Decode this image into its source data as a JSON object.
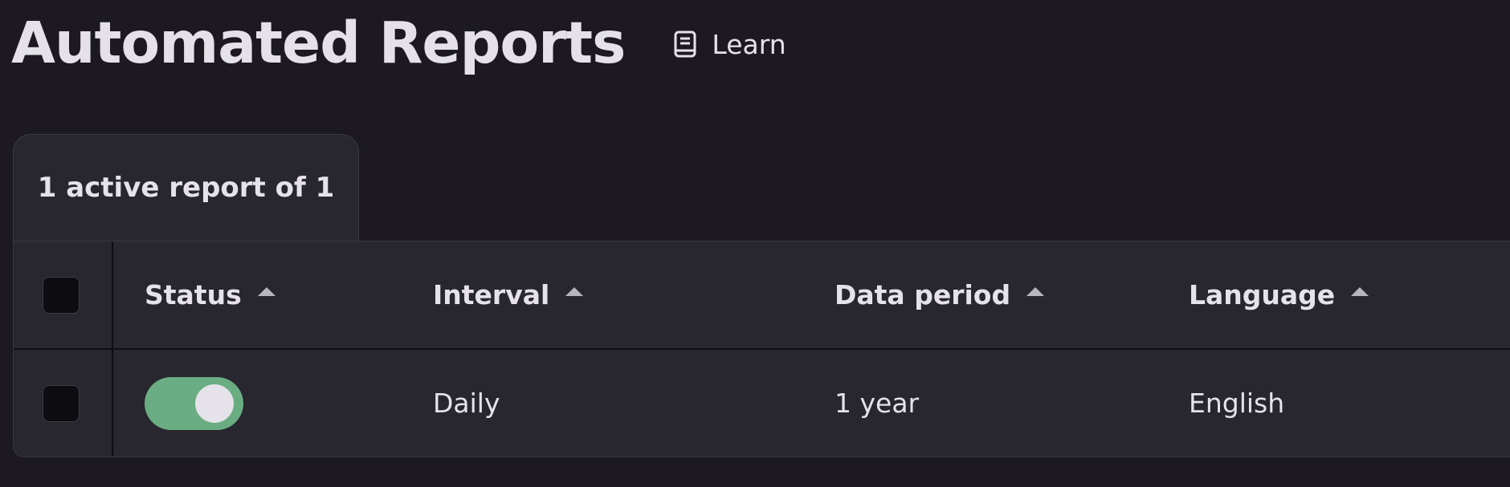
{
  "header": {
    "title": "Automated Reports",
    "learn_label": "Learn",
    "learn_icon": "book-icon"
  },
  "tab": {
    "label": "1 active report of 1"
  },
  "table": {
    "columns": [
      {
        "label": "Status",
        "sort": "ascending"
      },
      {
        "label": "Interval",
        "sort": "ascending"
      },
      {
        "label": "Data period",
        "sort": "ascending"
      },
      {
        "label": "Language",
        "sort": "ascending"
      }
    ],
    "rows": [
      {
        "status_enabled": true,
        "interval": "Daily",
        "data_period": "1 year",
        "language": "English"
      }
    ]
  },
  "colors": {
    "background": "#1c1a20",
    "surface": "#28262e",
    "toggle_on": "#6aad82",
    "text": "#e6e2ea"
  }
}
